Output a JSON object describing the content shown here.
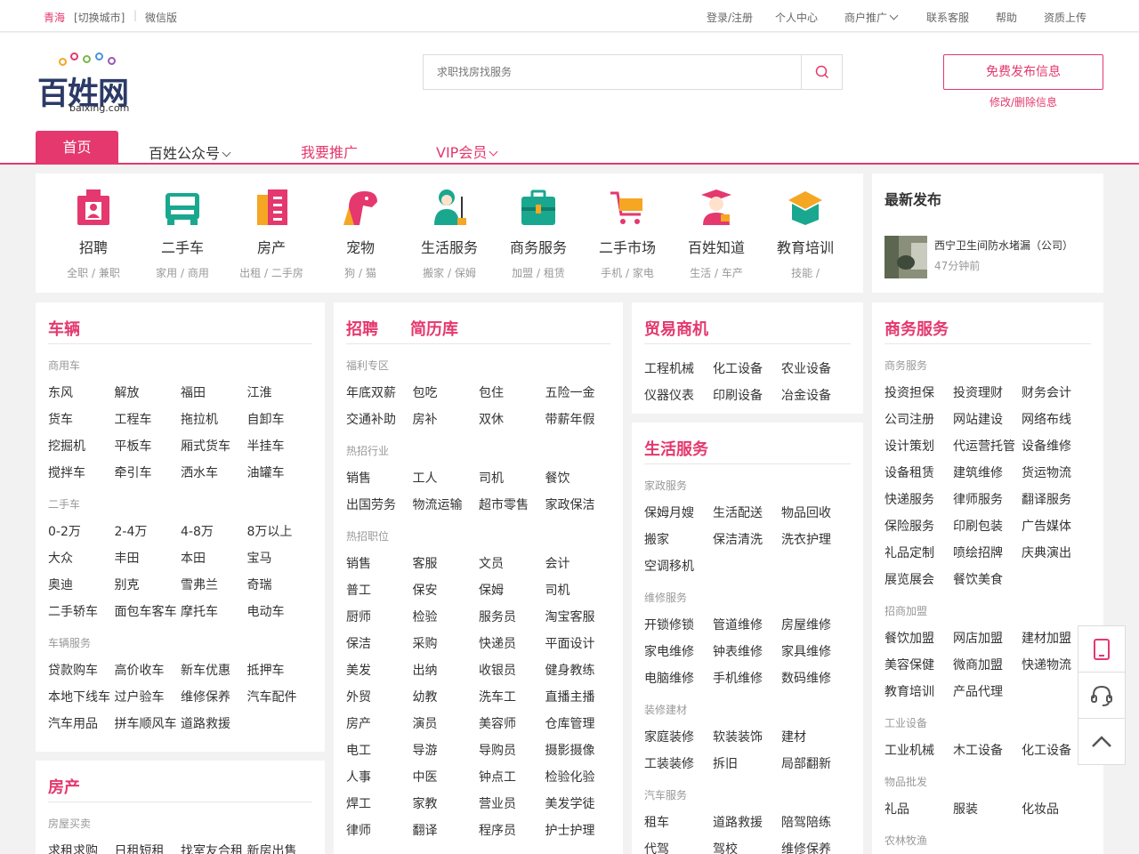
{
  "topbar": {
    "city": "青海",
    "switch_city": "[切换城市]",
    "separator": "|",
    "wechat": "微信版",
    "links": [
      "登录/注册",
      "个人中心",
      "商户推广",
      "联系客服",
      "帮助",
      "资质上传"
    ]
  },
  "logo": {
    "name": "百姓网",
    "domain": "baixing.com"
  },
  "search": {
    "placeholder": "求职找房找服务"
  },
  "publish": {
    "label": "免费发布信息",
    "modify": "修改/删除信息"
  },
  "nav": {
    "home": "首页",
    "public": "百姓公众号",
    "promote": "我要推广",
    "vip": "VIP会员"
  },
  "categories": [
    {
      "name": "招聘",
      "sub": "全职 / 兼职",
      "icon": "briefcase-person-icon"
    },
    {
      "name": "二手车",
      "sub": "家用 / 商用",
      "icon": "car-icon"
    },
    {
      "name": "房产",
      "sub": "出租 / 二手房",
      "icon": "building-icon"
    },
    {
      "name": "宠物",
      "sub": "狗 / 猫",
      "icon": "dog-icon"
    },
    {
      "name": "生活服务",
      "sub": "搬家 / 保姆",
      "icon": "cleaner-icon"
    },
    {
      "name": "商务服务",
      "sub": "加盟 / 租赁",
      "icon": "suitcase-icon"
    },
    {
      "name": "二手市场",
      "sub": "手机 / 家电",
      "icon": "cart-icon"
    },
    {
      "name": "百姓知道",
      "sub": "生活 / 车产",
      "icon": "graduate-icon"
    },
    {
      "name": "教育培训",
      "sub": "技能 /",
      "icon": "book-icon"
    }
  ],
  "latest": {
    "title": "最新发布",
    "item_title": "西宁卫生间防水堵漏（公司）",
    "item_time": "47分钟前"
  },
  "vehicles": {
    "title": "车辆",
    "sections": [
      {
        "label": "商用车",
        "items": [
          "东风",
          "解放",
          "福田",
          "江淮",
          "货车",
          "工程车",
          "拖拉机",
          "自卸车",
          "挖掘机",
          "平板车",
          "厢式货车",
          "半挂车",
          "搅拌车",
          "牵引车",
          "洒水车",
          "油罐车"
        ]
      },
      {
        "label": "二手车",
        "items": [
          "0-2万",
          "2-4万",
          "4-8万",
          "8万以上",
          "大众",
          "丰田",
          "本田",
          "宝马",
          "奥迪",
          "别克",
          "雪弗兰",
          "奇瑞",
          "二手轿车",
          "面包车客车",
          "摩托车",
          "电动车"
        ]
      },
      {
        "label": "车辆服务",
        "items": [
          "贷款购车",
          "高价收车",
          "新车优惠",
          "抵押车",
          "本地下线车",
          "过户验车",
          "维修保养",
          "汽车配件",
          "汽车用品",
          "拼车顺风车",
          "道路救援"
        ]
      }
    ]
  },
  "house": {
    "title": "房产",
    "sections": [
      {
        "label": "房屋买卖",
        "items": [
          "求租求购",
          "日租短租",
          "找室友合租",
          "新房出售"
        ]
      }
    ]
  },
  "jobs": {
    "title": "招聘",
    "title2": "简历库",
    "sections": [
      {
        "label": "福利专区",
        "items": [
          "年底双薪",
          "包吃",
          "包住",
          "五险一金",
          "交通补助",
          "房补",
          "双休",
          "带薪年假"
        ]
      },
      {
        "label": "热招行业",
        "items": [
          "销售",
          "工人",
          "司机",
          "餐饮",
          "出国劳务",
          "物流运输",
          "超市零售",
          "家政保洁"
        ]
      },
      {
        "label": "热招职位",
        "items": [
          "销售",
          "客服",
          "文员",
          "会计",
          "普工",
          "保安",
          "保姆",
          "司机",
          "厨师",
          "检验",
          "服务员",
          "淘宝客服",
          "保洁",
          "采购",
          "快递员",
          "平面设计",
          "美发",
          "出纳",
          "收银员",
          "健身教练",
          "外贸",
          "幼教",
          "洗车工",
          "直播主播",
          "房产",
          "演员",
          "美容师",
          "仓库管理",
          "电工",
          "导游",
          "导购员",
          "摄影摄像",
          "人事",
          "中医",
          "钟点工",
          "检验化验",
          "焊工",
          "家教",
          "营业员",
          "美发学徒",
          "律师",
          "翻译",
          "程序员",
          "护士护理"
        ]
      }
    ]
  },
  "trade": {
    "title": "贸易商机",
    "items": [
      "工程机械",
      "化工设备",
      "农业设备",
      "仪器仪表",
      "印刷设备",
      "冶金设备"
    ]
  },
  "life": {
    "title": "生活服务",
    "sections": [
      {
        "label": "家政服务",
        "items": [
          "保姆月嫂",
          "生活配送",
          "物品回收",
          "搬家",
          "保洁清洗",
          "洗衣护理",
          "空调移机"
        ]
      },
      {
        "label": "维修服务",
        "items": [
          "开锁修锁",
          "管道维修",
          "房屋维修",
          "家电维修",
          "钟表维修",
          "家具维修",
          "电脑维修",
          "手机维修",
          "数码维修"
        ]
      },
      {
        "label": "装修建材",
        "items": [
          "家庭装修",
          "软装装饰",
          "建材",
          "工装装修",
          "拆旧",
          "局部翻新"
        ]
      },
      {
        "label": "汽车服务",
        "items": [
          "租车",
          "道路救援",
          "陪驾陪练",
          "代驾",
          "驾校",
          "维修保养"
        ]
      }
    ]
  },
  "business": {
    "title": "商务服务",
    "sections": [
      {
        "label": "商务服务",
        "items": [
          "投资担保",
          "投资理财",
          "财务会计",
          "公司注册",
          "网站建设",
          "网络布线",
          "设计策划",
          "代运营托管",
          "设备维修",
          "设备租赁",
          "建筑维修",
          "货运物流",
          "快递服务",
          "律师服务",
          "翻译服务",
          "保险服务",
          "印刷包装",
          "广告媒体",
          "礼品定制",
          "喷绘招牌",
          "庆典演出",
          "展览展会",
          "餐饮美食"
        ]
      },
      {
        "label": "招商加盟",
        "items": [
          "餐饮加盟",
          "网店加盟",
          "建材加盟",
          "美容保健",
          "微商加盟",
          "快递物流",
          "教育培训",
          "产品代理"
        ]
      },
      {
        "label": "工业设备",
        "items": [
          "工业机械",
          "木工设备",
          "化工设备"
        ]
      },
      {
        "label": "物品批发",
        "items": [
          "礼品",
          "服装",
          "化妆品"
        ]
      },
      {
        "label": "农林牧渔",
        "items": []
      }
    ]
  },
  "side_tools": [
    "tablet-icon",
    "headset-icon",
    "back-to-top-icon"
  ]
}
